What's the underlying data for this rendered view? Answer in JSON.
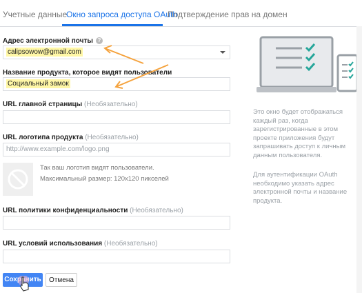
{
  "tabs": [
    {
      "label": "Учетные данные"
    },
    {
      "label": "Окно запроса доступа OAuth"
    },
    {
      "label": "Подтверждение прав на домен"
    }
  ],
  "form": {
    "email_label": "Адрес электронной почты",
    "email_value": "calipsowow@gmail.com",
    "product_label": "Название продукта, которое видят пользователи",
    "product_value": "Социальный замок",
    "homepage_label": "URL главной страницы",
    "logo_label": "URL логотипа продукта",
    "logo_placeholder": "http://www.example.com/logo.png",
    "logo_hint_1": "Так ваш логотип видят пользователи.",
    "logo_hint_2": "Максимальный размер: 120x120 пикселей",
    "privacy_label": "URL политики конфиденциальности",
    "terms_label": "URL условий использования",
    "optional_text": "(Необязательно)"
  },
  "side": {
    "text_1": "Это окно будет отображаться каждый раз, когда зарегистрированные в этом проекте приложения будут запрашивать доступ к личным данным пользователя.",
    "text_2": "Для аутентификации OAuth необходимо указать адрес электронной почты и название продукта."
  },
  "buttons": {
    "save": "Сохранить",
    "cancel": "Отмена"
  },
  "colors": {
    "accent": "#1a73e8",
    "annotation_arrow": "#f5a23c",
    "check_green": "#26a69a"
  }
}
